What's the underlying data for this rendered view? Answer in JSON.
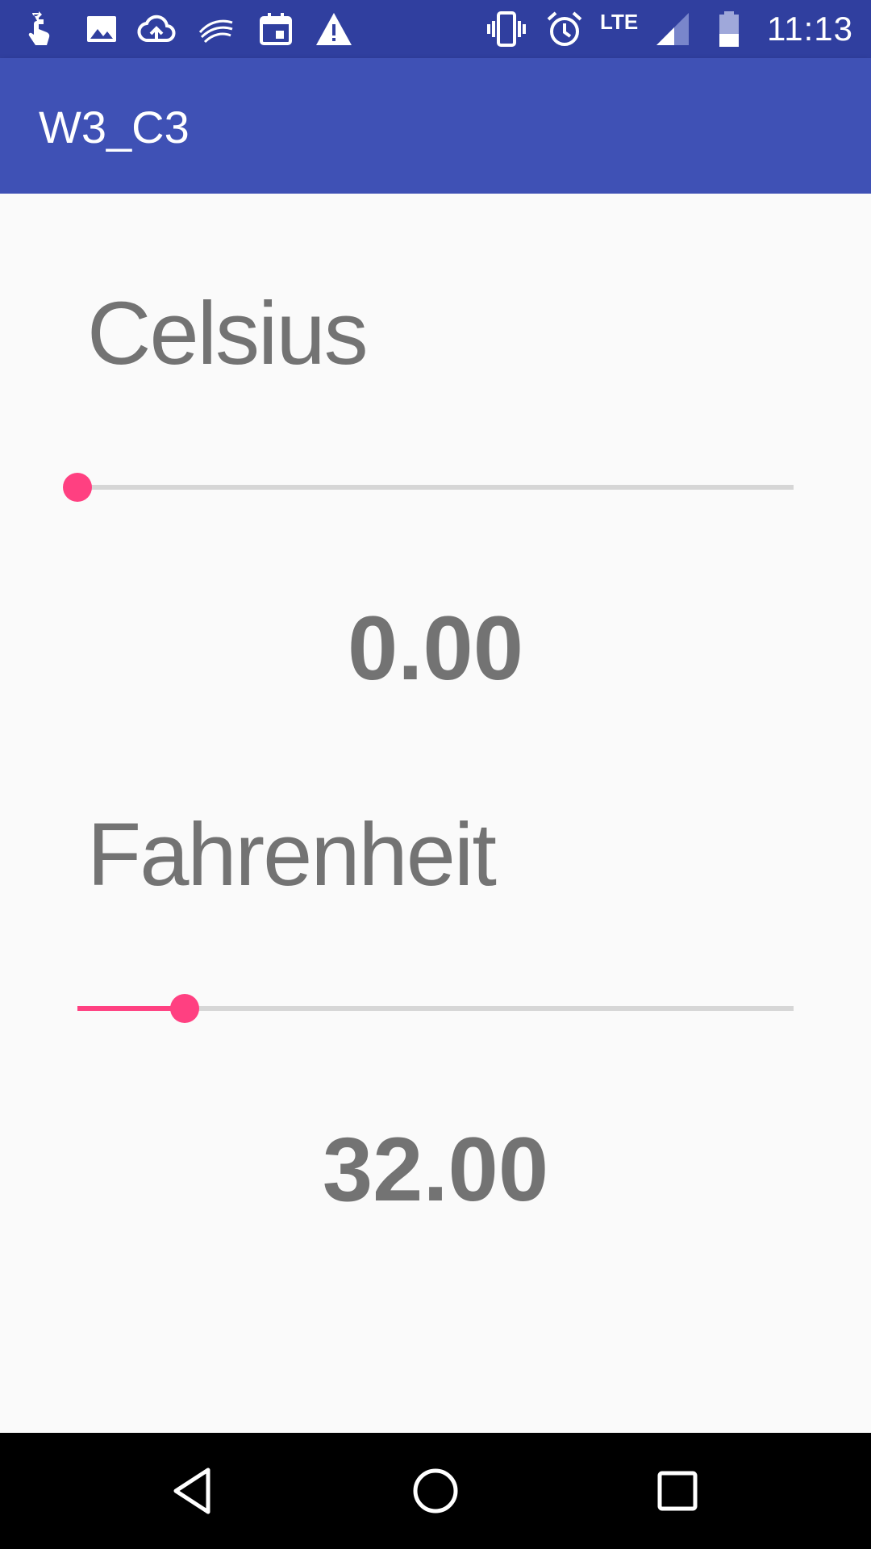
{
  "status_bar": {
    "time": "11:13",
    "network_label": "LTE",
    "icons": [
      "touch-notification-icon",
      "image-icon",
      "cloud-upload-icon",
      "swiftkey-icon",
      "calendar-icon",
      "warning-icon",
      "vibrate-icon",
      "alarm-icon",
      "lte-icon",
      "signal-icon",
      "battery-icon"
    ]
  },
  "app_bar": {
    "title": "W3_C3"
  },
  "celsius": {
    "label": "Celsius",
    "value": "0.00",
    "slider_fraction": 0.0
  },
  "fahrenheit": {
    "label": "Fahrenheit",
    "value": "32.00",
    "slider_fraction": 0.15
  },
  "colors": {
    "status_bar": "#303f9f",
    "app_bar": "#3f51b5",
    "accent": "#ff4081",
    "text": "#737373",
    "background": "#fafafa"
  },
  "nav_bar": {
    "icons": [
      "back-icon",
      "home-icon",
      "recents-icon"
    ]
  }
}
